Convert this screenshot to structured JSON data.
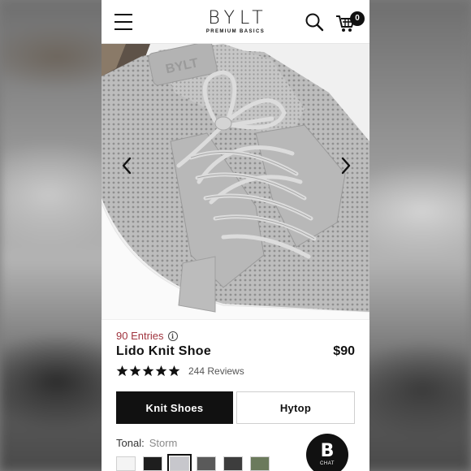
{
  "header": {
    "logo_text": "BYLT",
    "logo_subtext": "PREMIUM BASICS",
    "cart_count": "0",
    "icons": [
      "hamburger-menu-icon",
      "search-icon",
      "cart-icon"
    ]
  },
  "product": {
    "entries": "90 Entries",
    "title": "Lido Knit Shoe",
    "price": "$90",
    "rating": 5,
    "reviews": "244 Reviews"
  },
  "tabs": [
    {
      "label": "Knit Shoes",
      "active": true
    },
    {
      "label": "Hytop",
      "active": false
    }
  ],
  "tonal": {
    "label": "Tonal:",
    "value": "Storm"
  },
  "swatches": [
    {
      "color": "#f4f4f4"
    },
    {
      "color": "#1e1e1e"
    },
    {
      "color": "#c7c7cc",
      "selected": true
    },
    {
      "color": "#5a5a5a"
    },
    {
      "color": "#3d3d3d"
    },
    {
      "color": "#6b7a5c"
    }
  ],
  "chat": {
    "letter": "B",
    "label": "CHAT"
  },
  "colors": {
    "accent": "#a0343e",
    "primary": "#111111"
  }
}
